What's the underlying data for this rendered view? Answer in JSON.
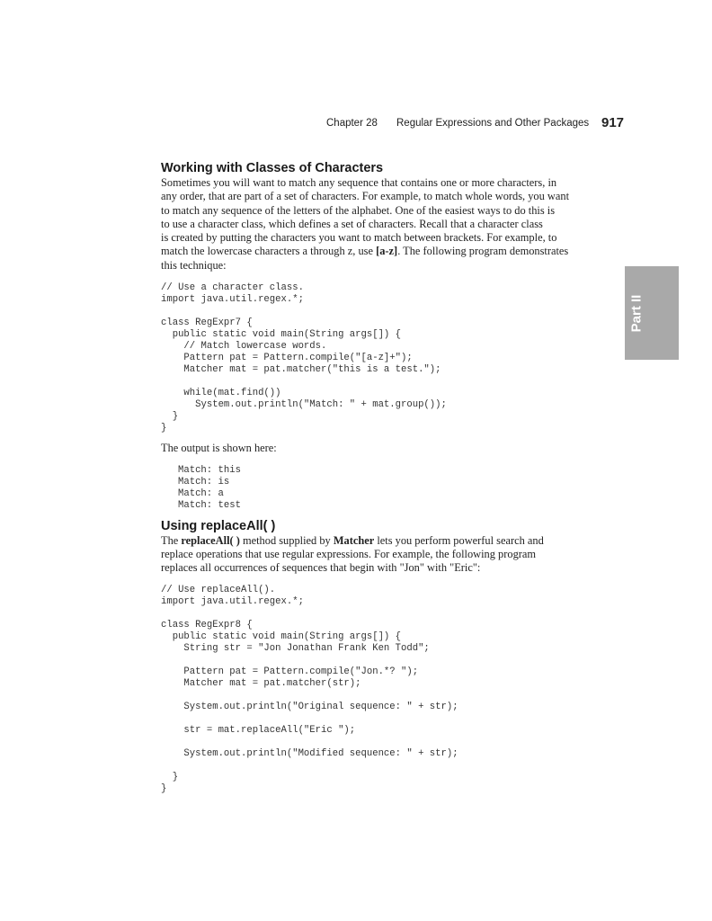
{
  "header": {
    "chapter_label": "Chapter 28",
    "chapter_title": "Regular Expressions and Other Packages",
    "page_number": "917"
  },
  "part_tab": {
    "label": "Part II"
  },
  "section1": {
    "heading": "Working with Classes of Characters",
    "paragraph": {
      "lines": [
        "Sometimes you will want to match any sequence that contains one or more characters, in",
        "any order, that are part of a set of characters. For example, to match whole words, you want",
        "to match any sequence of the letters of the alphabet. One of the easiest ways to do this is",
        "to use a character class, which defines a set of characters. Recall that a character class",
        "is created by putting the characters you want to match between brackets. For example, to"
      ],
      "line6_before": "match the lowercase characters a through z, use ",
      "line6_bold": "[a-z]",
      "line6_after": ". The following program demonstrates",
      "line7": "this technique:"
    },
    "code": "// Use a character class.\nimport java.util.regex.*;\n\nclass RegExpr7 {\n  public static void main(String args[]) {\n    // Match lowercase words.\n    Pattern pat = Pattern.compile(\"[a-z]+\");\n    Matcher mat = pat.matcher(\"this is a test.\");\n\n    while(mat.find())\n      System.out.println(\"Match: \" + mat.group());\n  }\n}",
    "output_intro": "The output is shown here:",
    "output": "Match: this\nMatch: is\nMatch: a\nMatch: test"
  },
  "section2": {
    "heading": "Using replaceAll( )",
    "paragraph": {
      "line1_a": "The ",
      "line1_b": "replaceAll( )",
      "line1_c": " method supplied by ",
      "line1_d": "Matcher",
      "line1_e": " lets you perform powerful search and",
      "line2": "replace operations that use regular expressions. For example, the following program",
      "line3": "replaces all occurrences of sequences that begin with \"Jon\" with \"Eric\":"
    },
    "code": "// Use replaceAll().\nimport java.util.regex.*;\n\nclass RegExpr8 {\n  public static void main(String args[]) {\n    String str = \"Jon Jonathan Frank Ken Todd\";\n\n    Pattern pat = Pattern.compile(\"Jon.*? \");\n    Matcher mat = pat.matcher(str);\n\n    System.out.println(\"Original sequence: \" + str);\n\n    str = mat.replaceAll(\"Eric \");\n\n    System.out.println(\"Modified sequence: \" + str);\n\n  }\n}"
  }
}
